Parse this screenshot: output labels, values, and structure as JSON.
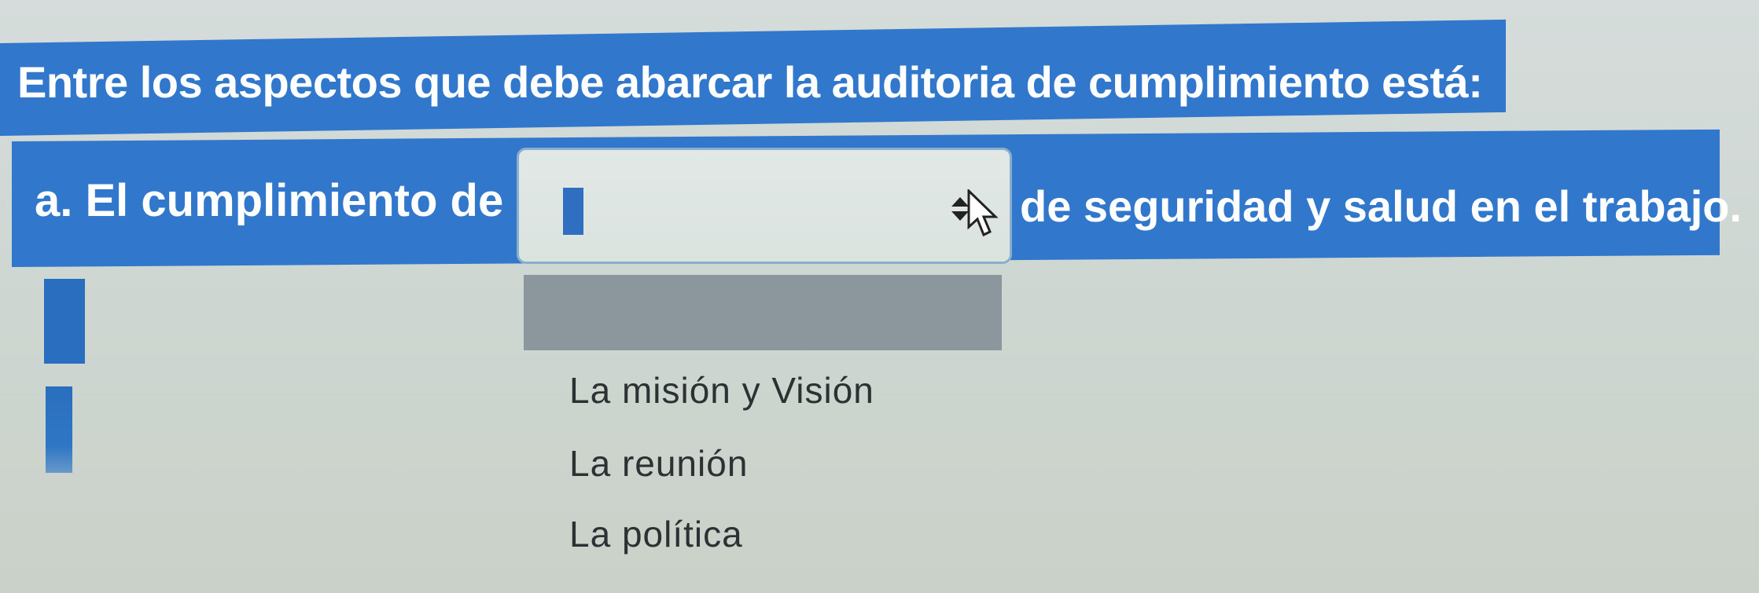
{
  "question": {
    "text": "Entre los aspectos que debe abarcar la auditoria de cumplimiento está:"
  },
  "answer_line": {
    "prefix": "a. El cumplimiento de",
    "suffix": "de seguridad y salud en el trabajo."
  },
  "dropdown": {
    "selected_value": "",
    "options": [
      "",
      "La misión y Visión",
      "La reunión",
      "La política"
    ]
  },
  "icons": {
    "dropdown_arrows": "sort-arrows-icon",
    "cursor": "mouse-cursor-icon"
  },
  "colors": {
    "banner_blue": "#3178cc",
    "highlight_gray": "#8c979d",
    "background": "#d0d8d4"
  }
}
